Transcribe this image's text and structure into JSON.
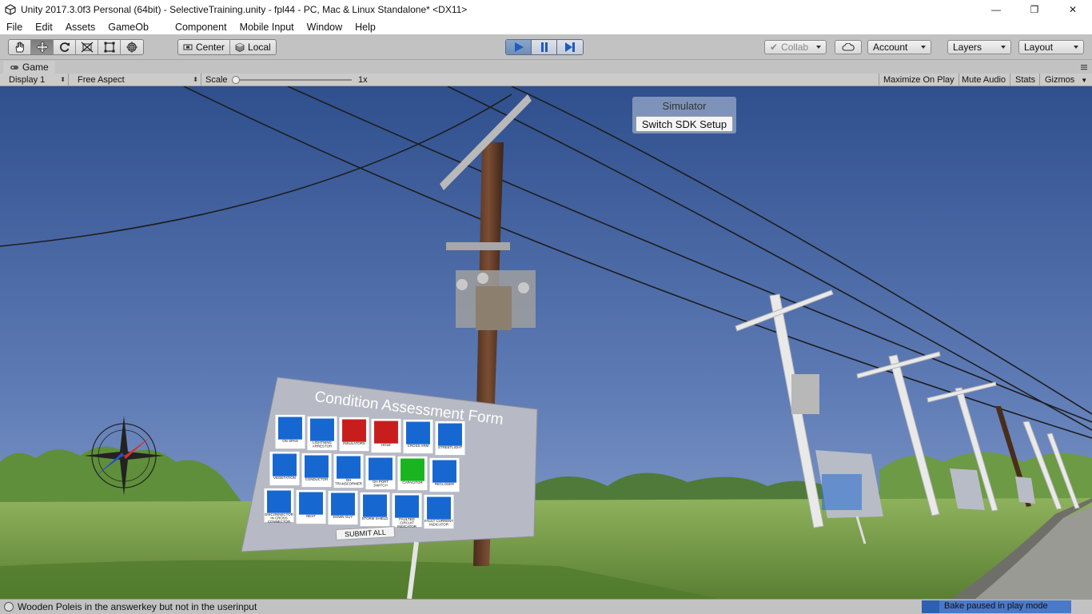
{
  "window": {
    "title": "Unity 2017.3.0f3 Personal (64bit) - SelectiveTraining.unity - fpl44 - PC, Mac & Linux Standalone* <DX11>",
    "minimize_glyph": "—",
    "maximize_glyph": "❐",
    "close_glyph": "✕"
  },
  "menu": [
    "File",
    "Edit",
    "Assets",
    "GameOb",
    "Component",
    "Mobile Input",
    "Window",
    "Help"
  ],
  "toolbar": {
    "tools": [
      "hand-icon",
      "move-icon",
      "rotate-icon",
      "scale-icon",
      "rect-icon",
      "transform-icon"
    ],
    "active_tool": "move-icon",
    "pivot_label": "Center",
    "space_label": "Local",
    "playback": [
      "play-icon",
      "pause-icon",
      "step-icon"
    ],
    "collab_label": "Collab",
    "account_label": "Account",
    "layers_label": "Layers",
    "layout_label": "Layout",
    "accent_color": "#3d7bd3"
  },
  "game_tab": {
    "label": "Game",
    "display": "Display 1",
    "aspect": "Free Aspect",
    "scale_label": "Scale",
    "scale_value": "1x",
    "scale_fraction": 0.0,
    "maximize": "Maximize On Play",
    "mute": "Mute Audio",
    "stats": "Stats",
    "gizmos": "Gizmos"
  },
  "scene": {
    "sky_color": "#4f6fa8",
    "grass_color": "#7aa048",
    "simulator": {
      "title": "Simulator",
      "button": "Switch SDK Setup"
    },
    "form": {
      "title": "Condition Assessment Form",
      "cards": [
        "ON SPAN",
        "LIGHTNING ARRESTOR",
        "INSULATORS",
        "HOLE",
        "CROSS ARM",
        "STREETLIGHT",
        "VEGETATION",
        "CONDUCTOR",
        "OH TRANSFORMER",
        "OH PORT SWITCH",
        "CAPACITOR",
        "RECLOSER",
        "DISCONNECTOR IN CROSS CONNECTOR",
        "NEST",
        "DOWN GUY",
        "STORM SHIELD",
        "FAULTED CIRCUIT INDICATOR",
        "FAULT CURRENT INDICATOR"
      ],
      "submit": "SUBMIT ALL"
    },
    "far_sign_title": "Condition Assessment Form"
  },
  "status": {
    "message": "Wooden Poleis in the answerkey but not in the userinput",
    "bake": "Bake paused in play mode",
    "bake_progress": 0.12
  }
}
